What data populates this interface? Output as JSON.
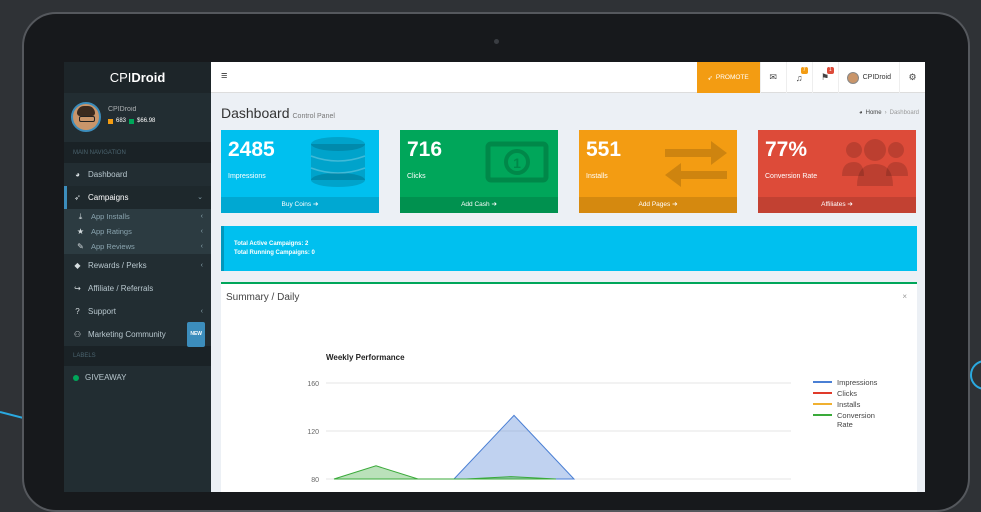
{
  "sidebar": {
    "logo_light": "CPI",
    "logo_bold": "Droid",
    "user_name": "CPIDroid",
    "coins": "683",
    "cash": "$66.98",
    "main_nav_header": "MAIN NAVIGATION",
    "items": [
      {
        "label": "Dashboard"
      },
      {
        "label": "Campaigns"
      },
      {
        "label": "App Installs"
      },
      {
        "label": "App Ratings"
      },
      {
        "label": "App Reviews"
      },
      {
        "label": "Rewards / Perks"
      },
      {
        "label": "Affiliate / Referrals"
      },
      {
        "label": "Support"
      },
      {
        "label": "Marketing Community",
        "badge": "NEW"
      }
    ],
    "labels_header": "LABELS",
    "giveaway": "GIVEAWAY"
  },
  "topbar": {
    "promote": "PROMOTE",
    "user_name": "CPIDroid",
    "notif_badge_1": "7",
    "notif_badge_2": "1"
  },
  "content": {
    "title": "Dashboard",
    "subtitle": "Control Panel",
    "breadcrumb_home": "Home",
    "breadcrumb_current": "Dashboard",
    "boxes": [
      {
        "value": "2485",
        "label": "Impressions",
        "link": "Buy Coins",
        "color": "#00c0ef"
      },
      {
        "value": "716",
        "label": "Clicks",
        "link": "Add Cash",
        "color": "#00a65a"
      },
      {
        "value": "551",
        "label": "Installs",
        "link": "Add Pages",
        "color": "#f39c12"
      },
      {
        "value": "77%",
        "label": "Conversion Rate",
        "link": "Affiliates",
        "color": "#dd4b39"
      }
    ],
    "callout_line1": "Total Active Campaigns: 2",
    "callout_line2": "Total Running Campaigns: 0",
    "panel_title": "Summary / Daily",
    "panel_close": "×"
  },
  "chart_data": {
    "type": "area",
    "title": "Weekly Performance",
    "ylim": [
      80,
      160
    ],
    "yticks": [
      160,
      120,
      80
    ],
    "series": [
      {
        "name": "Impressions",
        "color": "#4a7fd4",
        "points": [
          [
            480,
            80
          ],
          [
            540,
            133
          ],
          [
            600,
            80
          ]
        ]
      },
      {
        "name": "Clicks",
        "color": "#e03a2a",
        "points": []
      },
      {
        "name": "Installs",
        "color": "#f0b030",
        "points": []
      },
      {
        "name": "Conversion Rate",
        "color": "#3aaa3a",
        "points": [
          [
            360,
            80
          ],
          [
            402,
            91
          ],
          [
            444,
            80
          ],
          [
            492,
            80
          ],
          [
            537,
            82
          ],
          [
            582,
            80
          ]
        ]
      }
    ],
    "legend_position": "right"
  }
}
